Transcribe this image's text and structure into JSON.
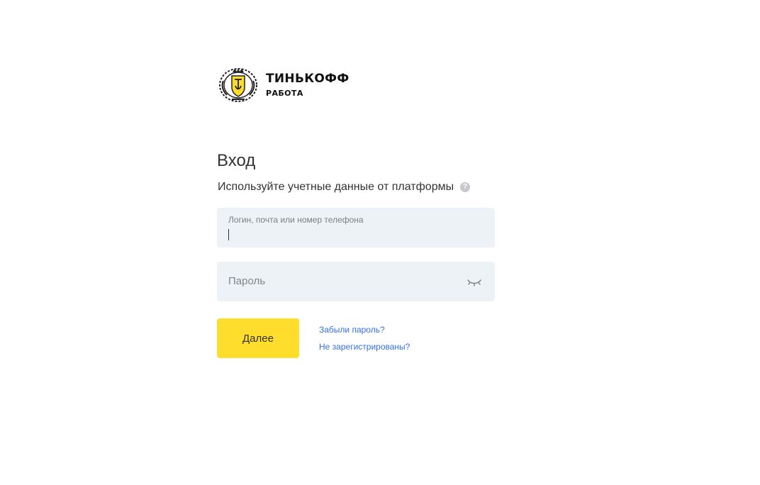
{
  "logo": {
    "brand": "ТИНЬКОФФ",
    "product": "РАБОТА"
  },
  "login": {
    "title": "Вход",
    "subtitle": "Используйте учетные данные от платформы",
    "help_icon_glyph": "?",
    "login_field": {
      "label": "Логин, почта или номер телефона",
      "value": ""
    },
    "password_field": {
      "placeholder": "Пароль",
      "value": ""
    },
    "next_button": "Далее",
    "forgot_password_link": "Забыли пароль?",
    "register_link": "Не зарегистрированы?"
  },
  "icons": {
    "logo": "tinkoff-emblem-icon",
    "help": "question-circle-icon",
    "password_toggle": "closed-eye-icon"
  },
  "colors": {
    "accent_yellow": "#ffdd2d",
    "field_background": "#edf2f6",
    "link_blue": "#336fee",
    "text_primary": "#333333",
    "text_secondary": "#7a7f86"
  }
}
